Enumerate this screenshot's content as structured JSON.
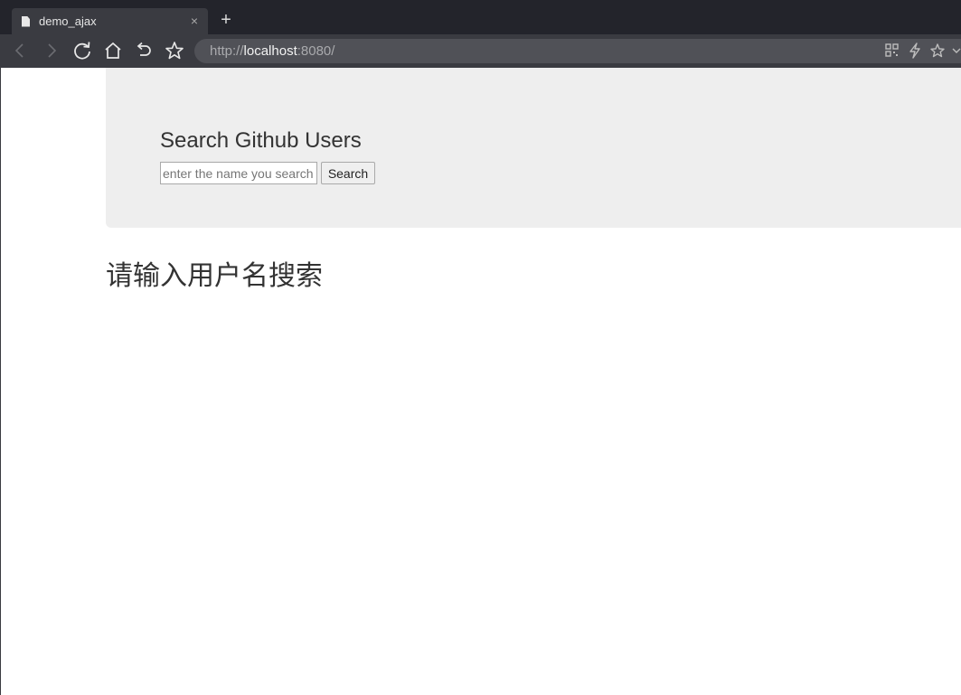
{
  "browser": {
    "tab": {
      "title": "demo_ajax",
      "close_glyph": "×",
      "icon": "document-icon"
    },
    "new_tab_glyph": "+",
    "address": {
      "scheme": "http://",
      "host": "localhost",
      "rest": ":8080/"
    },
    "toolbar_icons": [
      "back-icon",
      "forward-icon",
      "reload-icon",
      "home-icon",
      "undo-icon",
      "bookmark-star-icon"
    ],
    "right_icons": [
      "qr-code-icon",
      "lightning-icon",
      "favorites-star-icon",
      "chevron-down-icon"
    ]
  },
  "page": {
    "jumbotron": {
      "title": "Search Github Users",
      "input_placeholder": "enter the name you search",
      "input_value": "",
      "button_label": "Search"
    },
    "message": "请输入用户名搜索"
  },
  "colors": {
    "tab_strip": "#23242b",
    "toolbar": "#3a3b41",
    "jumbotron_bg": "#eeeeee",
    "text": "#333333"
  }
}
